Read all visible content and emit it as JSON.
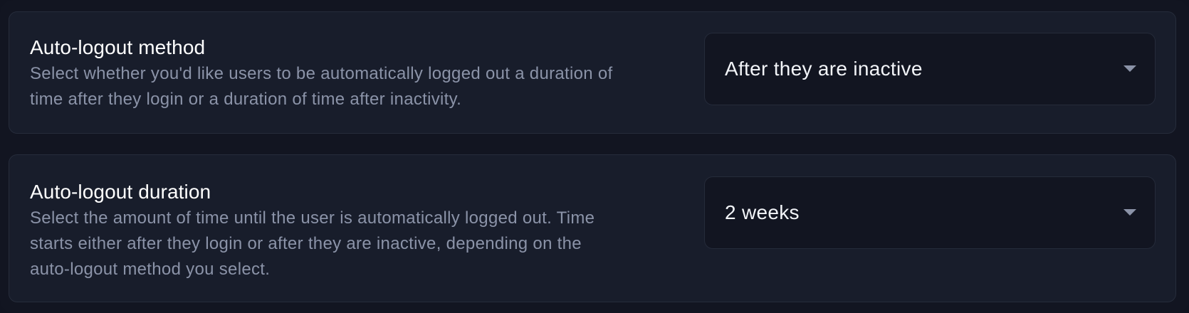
{
  "settings": {
    "method": {
      "title": "Auto-logout method",
      "description_lines": [
        "Select whether you'd like users to be automatically logged out a duration of",
        "time after they login or a duration of time after inactivity."
      ],
      "selected": "After they are inactive",
      "icon": "chevron-down-icon"
    },
    "duration": {
      "title": "Auto-logout duration",
      "description_lines": [
        "Select the amount of time until the user is automatically logged out. Time",
        "starts either after they login or after they are inactive, depending on the",
        "auto-logout method you select."
      ],
      "selected": "2 weeks",
      "icon": "chevron-down-icon"
    }
  },
  "colors": {
    "background": "#121521",
    "card": "#181d2b",
    "select_background": "#121521",
    "title_text": "#ffffff",
    "description_text": "#8b93a8"
  }
}
